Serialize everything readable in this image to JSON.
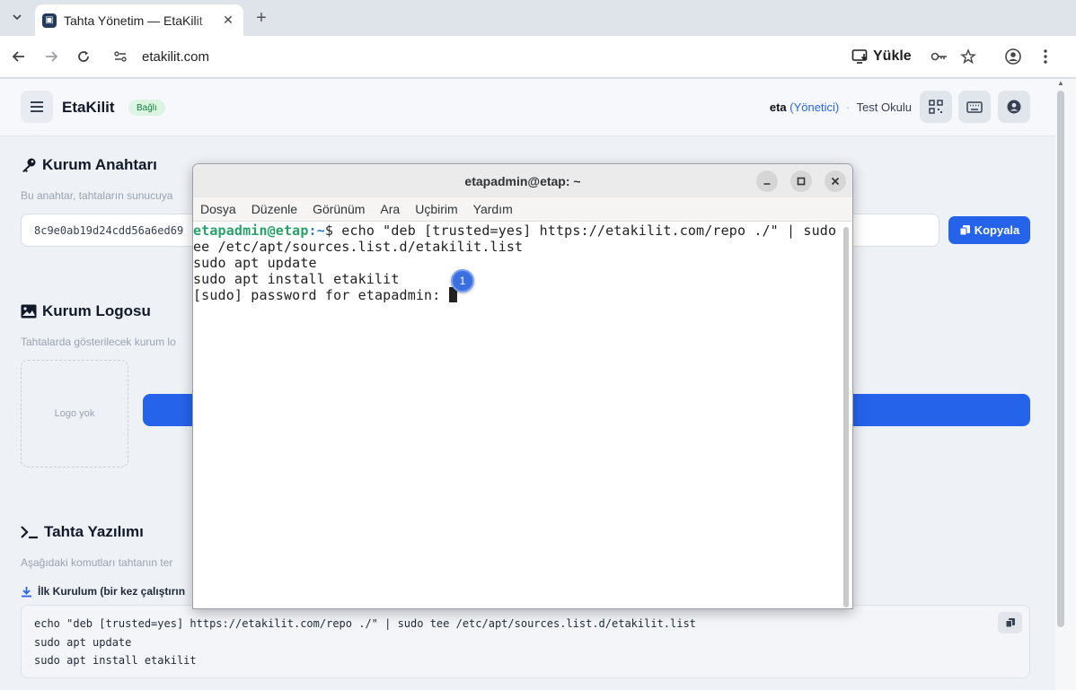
{
  "browser": {
    "tab_title": "Tahta Yönetim — EtaKilit",
    "url": "etakilit.com",
    "install_label": "Yükle"
  },
  "app": {
    "brand": "EtaKilit",
    "status": "Bağlı",
    "user": "eta",
    "role": "(Yönetici)",
    "separator": "·",
    "school": "Test Okulu"
  },
  "sections": {
    "key": {
      "title": "Kurum Anahtarı",
      "desc": "Bu anahtar, tahtaların sunucuya",
      "value": "8c9e0ab19d24cdd56a6ed69",
      "copy_label": "Kopyala"
    },
    "logo": {
      "title": "Kurum Logosu",
      "desc": "Tahtalarda gösterilecek kurum lo",
      "empty": "Logo yok"
    },
    "software": {
      "title": "Tahta Yazılımı",
      "desc": "Aşağıdaki komutları tahtanın ter",
      "install_label": "İlk Kurulum (bir kez çalıştırın",
      "code": [
        "echo \"deb [trusted=yes] https://etakilit.com/repo ./\" | sudo tee /etc/apt/sources.list.d/etakilit.list",
        "sudo apt update",
        "sudo apt install etakilit"
      ]
    }
  },
  "terminal": {
    "title": "etapadmin@etap: ~",
    "menu": [
      "Dosya",
      "Düzenle",
      "Görünüm",
      "Ara",
      "Uçbirim",
      "Yardım"
    ],
    "prompt_user": "etapadmin@etap",
    "prompt_path": ":~",
    "prompt_sym": "$ ",
    "lines": [
      "echo \"deb [trusted=yes] https://etakilit.com/repo ./\" | sudo t",
      "ee /etc/apt/sources.list.d/etakilit.list",
      "sudo apt update",
      "sudo apt install etakilit",
      "[sudo] password for etapadmin: "
    ]
  },
  "marker": {
    "label": "1",
    "color": "#3b6fe0"
  },
  "colors": {
    "accent": "#2563eb",
    "success_bg": "#dcf5e3",
    "success_fg": "#15803d"
  }
}
